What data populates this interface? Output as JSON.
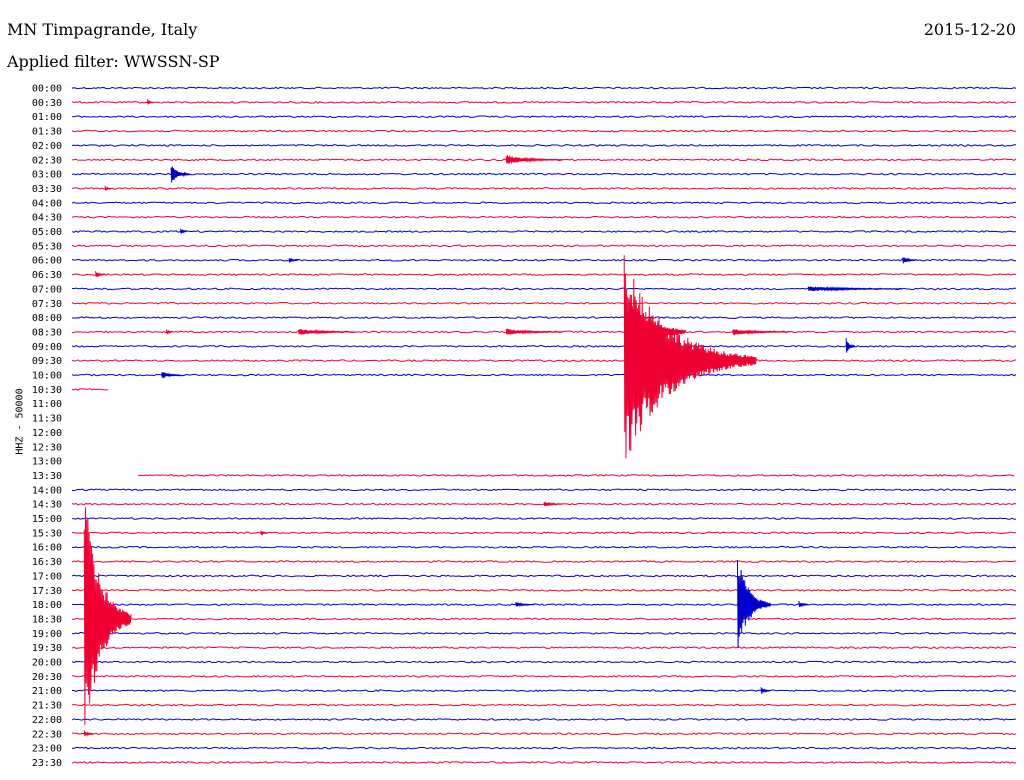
{
  "header": {
    "station": "MN Timpagrande, Italy",
    "date": "2015-12-20",
    "filter": "Applied filter: WWSSN-SP"
  },
  "chart_data": {
    "type": "line",
    "title": "MN Timpagrande, Italy",
    "subtitle": "Applied filter: WWSSN-SP",
    "ylabel": "HHZ - 50000",
    "xlabel": "",
    "row_labels": [
      "00:00",
      "00:30",
      "01:00",
      "01:30",
      "02:00",
      "02:30",
      "03:00",
      "03:30",
      "04:00",
      "04:30",
      "05:00",
      "05:30",
      "06:00",
      "06:30",
      "07:00",
      "07:30",
      "08:00",
      "08:30",
      "09:00",
      "09:30",
      "10:00",
      "10:30",
      "11:00",
      "11:30",
      "12:00",
      "12:30",
      "13:00",
      "13:30",
      "14:00",
      "14:30",
      "15:00",
      "15:30",
      "16:00",
      "16:30",
      "17:00",
      "17:30",
      "18:00",
      "18:30",
      "19:00",
      "19:30",
      "20:00",
      "20:30",
      "21:00",
      "21:30",
      "22:00",
      "22:30",
      "23:00",
      "23:30"
    ],
    "series_colors": [
      "#0000cc",
      "#ee0033"
    ],
    "rows_per_hour": 2,
    "row_duration_minutes": 30,
    "data_gap": {
      "start": "10:30",
      "end": "13:30",
      "note_trace_10_30_extent_fraction": 0.04,
      "trace_13_30_start_fraction": 0.07
    },
    "events": [
      {
        "row": "00:30",
        "pos": 0.08,
        "amp": 0.25,
        "len": 0.005
      },
      {
        "row": "02:30",
        "pos": 0.46,
        "amp": 0.35,
        "len": 0.06
      },
      {
        "row": "03:00",
        "pos": 0.105,
        "amp": 0.7,
        "len": 0.02
      },
      {
        "row": "03:30",
        "pos": 0.035,
        "amp": 0.2,
        "len": 0.005
      },
      {
        "row": "05:00",
        "pos": 0.115,
        "amp": 0.3,
        "len": 0.003
      },
      {
        "row": "06:00",
        "pos": 0.23,
        "amp": 0.2,
        "len": 0.01
      },
      {
        "row": "06:00",
        "pos": 0.88,
        "amp": 0.3,
        "len": 0.015
      },
      {
        "row": "06:30",
        "pos": 0.025,
        "amp": 0.3,
        "len": 0.01
      },
      {
        "row": "07:00",
        "pos": 0.78,
        "amp": 0.2,
        "len": 0.1
      },
      {
        "row": "08:30",
        "pos": 0.1,
        "amp": 0.25,
        "len": 0.005
      },
      {
        "row": "08:30",
        "pos": 0.24,
        "amp": 0.25,
        "len": 0.06
      },
      {
        "row": "08:30",
        "pos": 0.46,
        "amp": 0.25,
        "len": 0.06
      },
      {
        "row": "08:30",
        "pos": 0.59,
        "amp": 3.5,
        "len": 0.06
      },
      {
        "row": "08:30",
        "pos": 0.7,
        "amp": 0.25,
        "len": 0.06
      },
      {
        "row": "09:00",
        "pos": 0.82,
        "amp": 0.6,
        "len": 0.01
      },
      {
        "row": "09:30",
        "pos": 0.585,
        "amp": 7.5,
        "len": 0.14
      },
      {
        "row": "10:00",
        "pos": 0.095,
        "amp": 0.3,
        "len": 0.02
      },
      {
        "row": "14:30",
        "pos": 0.5,
        "amp": 0.2,
        "len": 0.02
      },
      {
        "row": "15:30",
        "pos": 0.2,
        "amp": 0.25,
        "len": 0.005
      },
      {
        "row": "18:30",
        "pos": 0.013,
        "amp": 9.0,
        "len": 0.05
      },
      {
        "row": "18:00",
        "pos": 0.705,
        "amp": 3.5,
        "len": 0.035
      },
      {
        "row": "18:00",
        "pos": 0.47,
        "amp": 0.2,
        "len": 0.02
      },
      {
        "row": "18:00",
        "pos": 0.77,
        "amp": 0.3,
        "len": 0.01
      },
      {
        "row": "21:00",
        "pos": 0.73,
        "amp": 0.3,
        "len": 0.01
      },
      {
        "row": "22:30",
        "pos": 0.013,
        "amp": 0.3,
        "len": 0.01
      }
    ]
  }
}
